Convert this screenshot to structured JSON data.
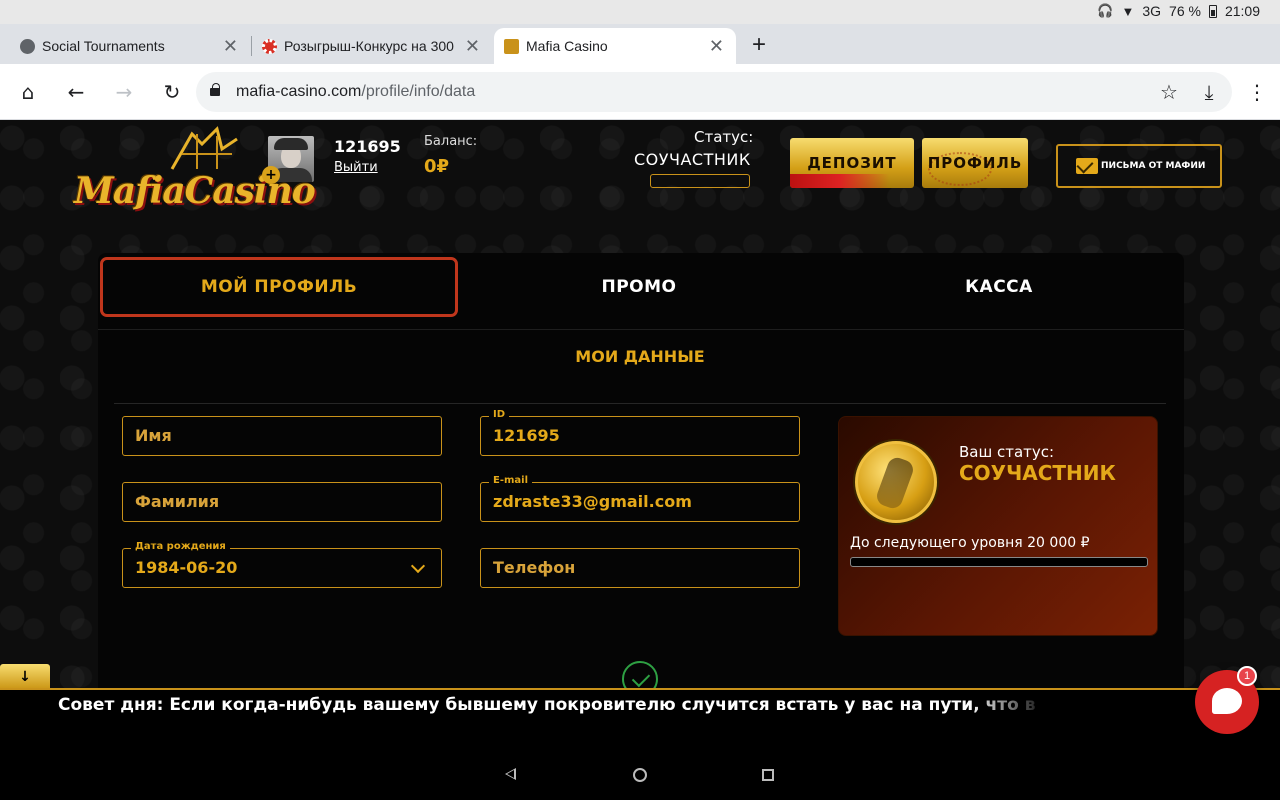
{
  "statusbar": {
    "network": "3G",
    "battery": "76 %",
    "time": "21:09"
  },
  "tabs": [
    {
      "title": "Social Tournaments",
      "fav_color": "#5f6368"
    },
    {
      "title": "Розыгрыш-Конкурс на 300",
      "fav_color": "#d93025"
    },
    {
      "title": "Mafia Casino",
      "fav_color": "#c9921a"
    }
  ],
  "toolbar": {
    "url_host": "mafia-casino.com",
    "url_path": "/profile/info/data"
  },
  "header": {
    "logo_text": "MafiaCasino",
    "user_id": "121695",
    "logout": "Выйти",
    "balance_label": "Баланс:",
    "balance_value": "0₽",
    "status_label": "Статус:",
    "status_value": "СОУЧАСТНИК",
    "deposit_button": "ДЕПОЗИТ",
    "profile_button": "ПРОФИЛЬ",
    "letters_button": "ПИСЬМА ОТ МАФИИ"
  },
  "panel": {
    "tabs": {
      "profile": "МОЙ ПРОФИЛЬ",
      "promo": "ПРОМО",
      "cash": "КАССА"
    },
    "section_title": "МОИ ДАННЫЕ",
    "fields": {
      "first_name": {
        "placeholder": "Имя"
      },
      "last_name": {
        "placeholder": "Фамилия"
      },
      "birth_date": {
        "label": "Дата рождения",
        "value": "1984-06-20"
      },
      "id": {
        "label": "ID",
        "value": "121695"
      },
      "email": {
        "label": "E-mail",
        "value": "zdraste33@gmail.com"
      },
      "phone": {
        "placeholder": "Телефон"
      }
    },
    "status_card": {
      "label": "Ваш статус:",
      "value": "СОУЧАСТНИК",
      "next_level": "До следующего уровня 20 000 ₽",
      "progress": 0
    }
  },
  "ticker": {
    "text": "Совет дня: Если когда-нибудь вашему бывшему покровителю случится встать у вас на пути, что в"
  },
  "chat": {
    "badge": "1"
  },
  "colors": {
    "gold": "#e4a91a",
    "accent_red": "#c0361c"
  }
}
